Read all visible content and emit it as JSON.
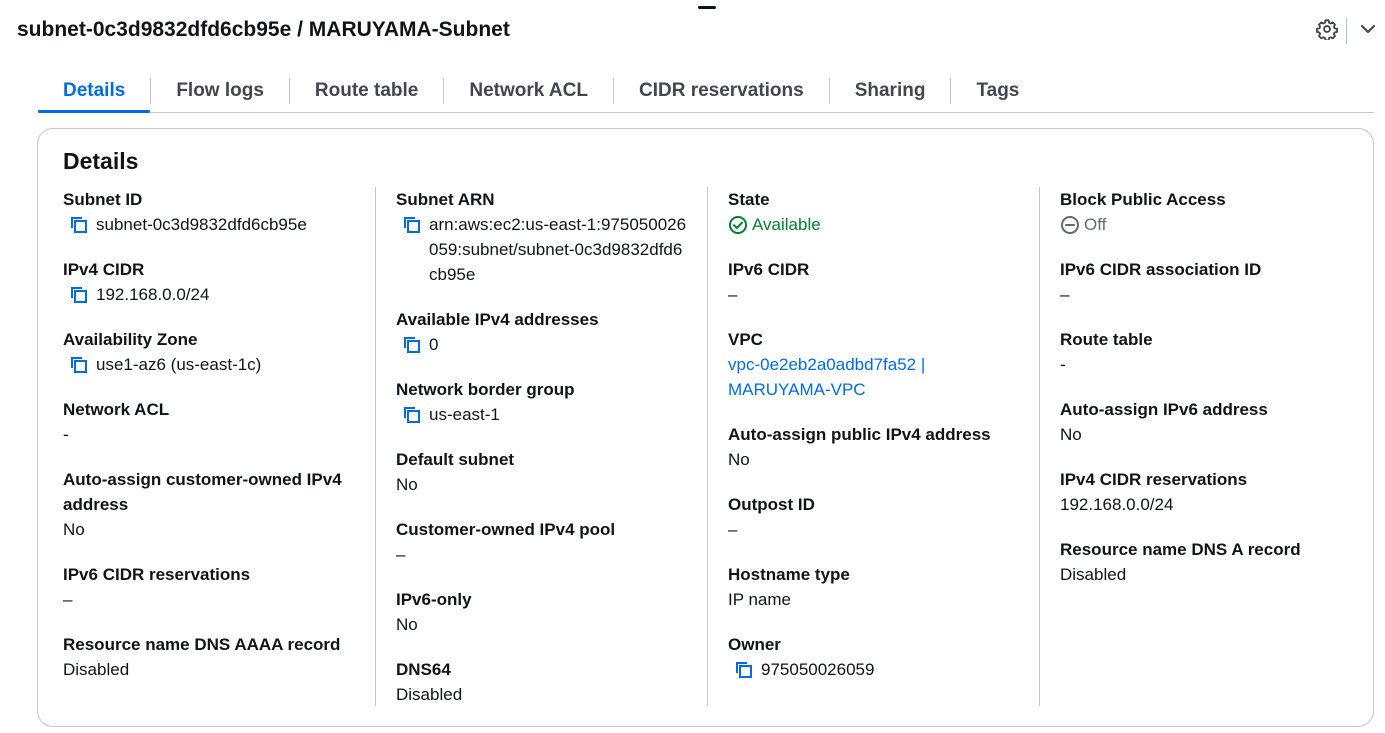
{
  "header": {
    "title": "subnet-0c3d9832dfd6cb95e / MARUYAMA-Subnet"
  },
  "tabs": [
    {
      "label": "Details"
    },
    {
      "label": "Flow logs"
    },
    {
      "label": "Route table"
    },
    {
      "label": "Network ACL"
    },
    {
      "label": "CIDR reservations"
    },
    {
      "label": "Sharing"
    },
    {
      "label": "Tags"
    }
  ],
  "details": {
    "title": "Details",
    "col1": {
      "subnet_id": {
        "label": "Subnet ID",
        "value": "subnet-0c3d9832dfd6cb95e"
      },
      "ipv4_cidr": {
        "label": "IPv4 CIDR",
        "value": "192.168.0.0/24"
      },
      "availability_zone": {
        "label": "Availability Zone",
        "value": "use1-az6 (us-east-1c)"
      },
      "network_acl": {
        "label": "Network ACL",
        "value": "-"
      },
      "auto_assign_customer_ipv4": {
        "label": "Auto-assign customer-owned IPv4 address",
        "value": "No"
      },
      "ipv6_cidr_reservations": {
        "label": "IPv6 CIDR reservations",
        "value": "–"
      },
      "dns_aaaa": {
        "label": "Resource name DNS AAAA record",
        "value": "Disabled"
      }
    },
    "col2": {
      "subnet_arn": {
        "label": "Subnet ARN",
        "value": "arn:aws:ec2:us-east-1:975050026059:subnet/subnet-0c3d9832dfd6cb95e"
      },
      "available_ipv4": {
        "label": "Available IPv4 addresses",
        "value": "0"
      },
      "network_border_group": {
        "label": "Network border group",
        "value": "us-east-1"
      },
      "default_subnet": {
        "label": "Default subnet",
        "value": "No"
      },
      "customer_ipv4_pool": {
        "label": "Customer-owned IPv4 pool",
        "value": "–"
      },
      "ipv6_only": {
        "label": "IPv6-only",
        "value": "No"
      },
      "dns64": {
        "label": "DNS64",
        "value": "Disabled"
      }
    },
    "col3": {
      "state": {
        "label": "State",
        "value": "Available"
      },
      "ipv6_cidr": {
        "label": "IPv6 CIDR",
        "value": "–"
      },
      "vpc": {
        "label": "VPC",
        "value_line1": "vpc-0e2eb2a0adbd7fa52 |",
        "value_line2": "MARUYAMA-VPC"
      },
      "auto_assign_public_ipv4": {
        "label": "Auto-assign public IPv4 address",
        "value": "No"
      },
      "outpost_id": {
        "label": "Outpost ID",
        "value": "–"
      },
      "hostname_type": {
        "label": "Hostname type",
        "value": "IP name"
      },
      "owner": {
        "label": "Owner",
        "value": "975050026059"
      }
    },
    "col4": {
      "block_public_access": {
        "label": "Block Public Access",
        "value": "Off"
      },
      "ipv6_cidr_association_id": {
        "label": "IPv6 CIDR association ID",
        "value": "–"
      },
      "route_table": {
        "label": "Route table",
        "value": "-"
      },
      "auto_assign_ipv6": {
        "label": "Auto-assign IPv6 address",
        "value": "No"
      },
      "ipv4_cidr_reservations": {
        "label": "IPv4 CIDR reservations",
        "value": "192.168.0.0/24"
      },
      "dns_a": {
        "label": "Resource name DNS A record",
        "value": "Disabled"
      }
    }
  },
  "icons": {
    "copy": "copy-icon",
    "settings": "gear-icon",
    "collapse": "chevron-down-icon",
    "status_available": "check-circle-icon",
    "status_off": "minus-circle-icon"
  },
  "colors": {
    "accent": "#006ce0",
    "success": "#00802f",
    "muted": "#656871",
    "border": "#c6c6cd"
  }
}
